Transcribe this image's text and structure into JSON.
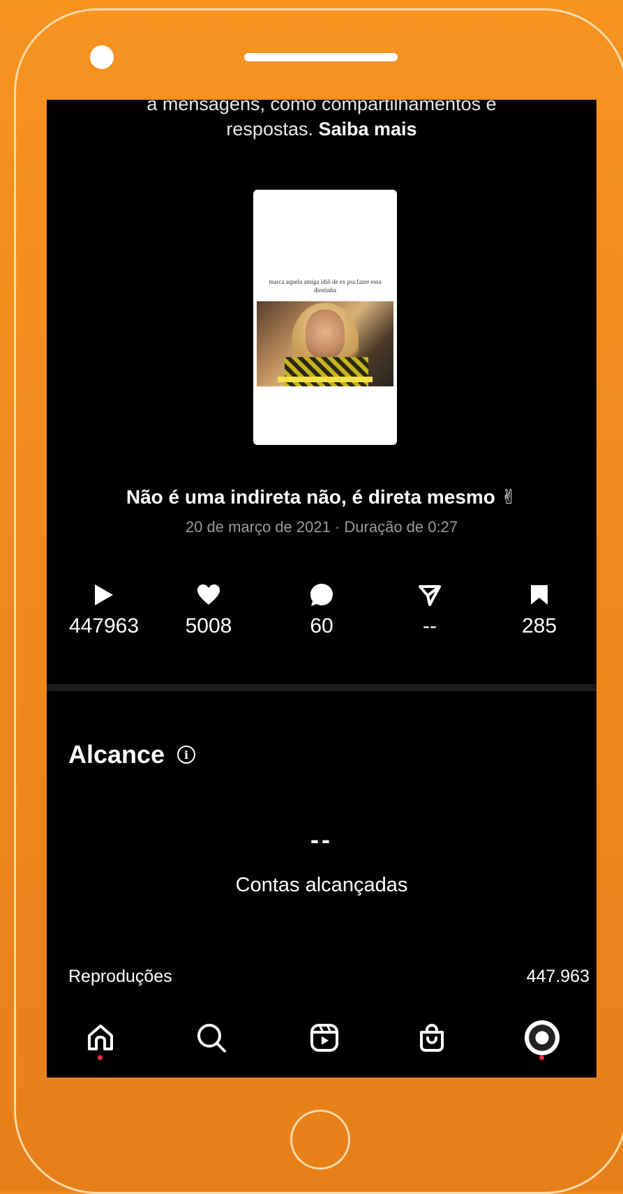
{
  "notice": {
    "line1": "a mensagens, como compartilhamentos e",
    "line2_prefix": "respostas. ",
    "link": "Saiba mais"
  },
  "thumbnail": {
    "caption": "marca aquela amiga idiô de ex pra fazer essa diretinha"
  },
  "post": {
    "title": "Não é uma indireta não, é direta mesmo ✌",
    "meta": "20 de março de 2021 · Duração de 0:27"
  },
  "stats": [
    {
      "icon": "play-icon",
      "value": "447963"
    },
    {
      "icon": "heart-icon",
      "value": "5008"
    },
    {
      "icon": "comment-icon",
      "value": "60"
    },
    {
      "icon": "share-icon",
      "value": "--"
    },
    {
      "icon": "bookmark-icon",
      "value": "285"
    }
  ],
  "reach": {
    "title": "Alcance",
    "value": "--",
    "label": "Contas alcançadas"
  },
  "metrics": {
    "plays_label": "Reproduções",
    "plays_value": "447.963"
  },
  "nav": {
    "items": [
      "home-icon",
      "search-icon",
      "reels-icon",
      "shop-icon",
      "profile-avatar"
    ]
  },
  "colors": {
    "frame": "#f08a1e",
    "screen": "#000000",
    "badge": "#ff3040"
  }
}
